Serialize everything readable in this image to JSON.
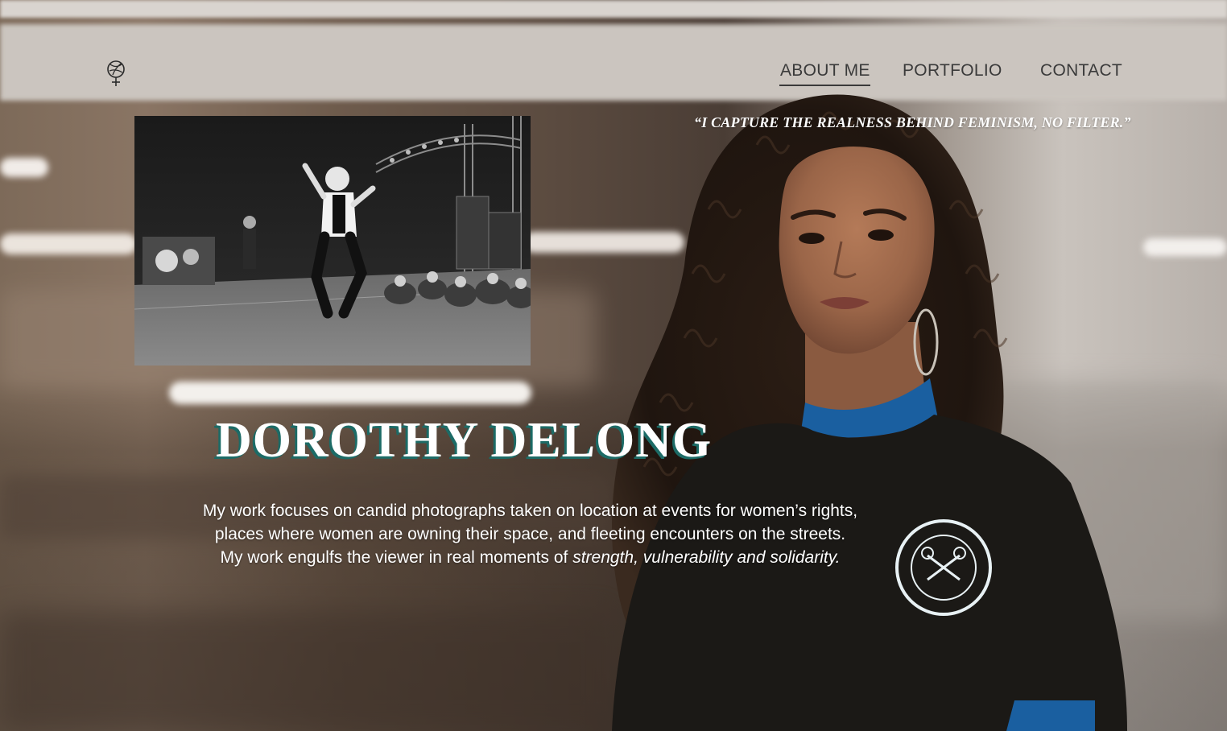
{
  "nav": {
    "logo_icon": "venus-rose-logo-icon",
    "items": [
      {
        "label": "ABOUT ME",
        "active": true
      },
      {
        "label": "PORTFOLIO",
        "active": false
      },
      {
        "label": "CONTACT",
        "active": false
      }
    ]
  },
  "hero": {
    "quote": "“I CAPTURE THE REALNESS BEHIND FEMINISM, NO FILTER.”",
    "name": "DOROTHY DELONG",
    "bio": {
      "line1": "My work focuses on candid photographs taken on location at events for women’s rights,",
      "line2": "places where women are owning their space, and fleeting encounters on the streets.",
      "line3_prefix": "My work engulfs the viewer in real moments of ",
      "line3_emphasis": "strength, vulnerability and solidarity."
    },
    "photo_subject": "black-and-white concert stage photo",
    "portrait_subject": "woman in black t-shirt portrait"
  },
  "colors": {
    "name_shadow": "#1c6b66",
    "nav_text": "#3a3a3a",
    "text": "#ffffff"
  }
}
